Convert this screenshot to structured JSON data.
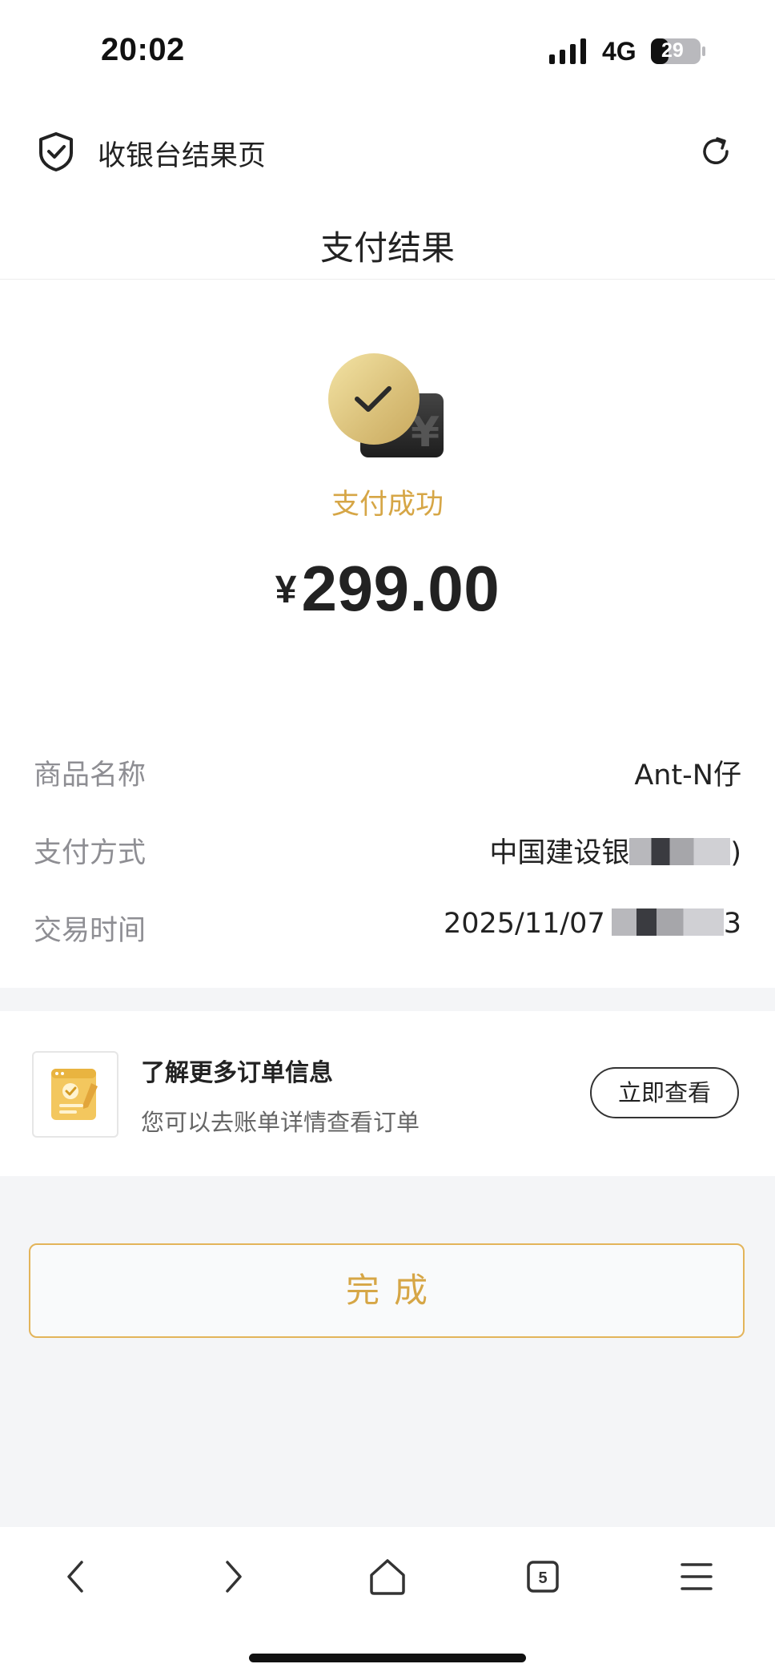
{
  "status_bar": {
    "time": "20:02",
    "network": "4G",
    "battery_level": "29",
    "icons": [
      "signal-icon",
      "battery-icon"
    ]
  },
  "browser": {
    "title": "收银台结果页",
    "icons": [
      "shield-check-icon",
      "refresh-icon"
    ]
  },
  "page": {
    "title": "支付结果"
  },
  "result": {
    "status_text": "支付成功",
    "currency_symbol": "¥",
    "amount": "299.00",
    "icon": "payment-success-icon",
    "accent_color": "#d6a646"
  },
  "details": [
    {
      "label": "商品名称",
      "value": "Ant-N仔"
    },
    {
      "label": "支付方式",
      "value_prefix": "中国建设银",
      "value_suffix": ")"
    },
    {
      "label": "交易时间",
      "value_prefix": "2025/11/07",
      "value_suffix": "3"
    }
  ],
  "order_info": {
    "title": "了解更多订单信息",
    "subtitle": "您可以去账单详情查看订单",
    "button_label": "立即查看",
    "icon": "bill-document-icon"
  },
  "done_button": {
    "label": "完成",
    "border_color": "#e3b45a"
  },
  "toolbar": {
    "tabs_count": "5",
    "icons": [
      "back-icon",
      "forward-icon",
      "home-icon",
      "tabs-icon",
      "menu-icon"
    ]
  }
}
